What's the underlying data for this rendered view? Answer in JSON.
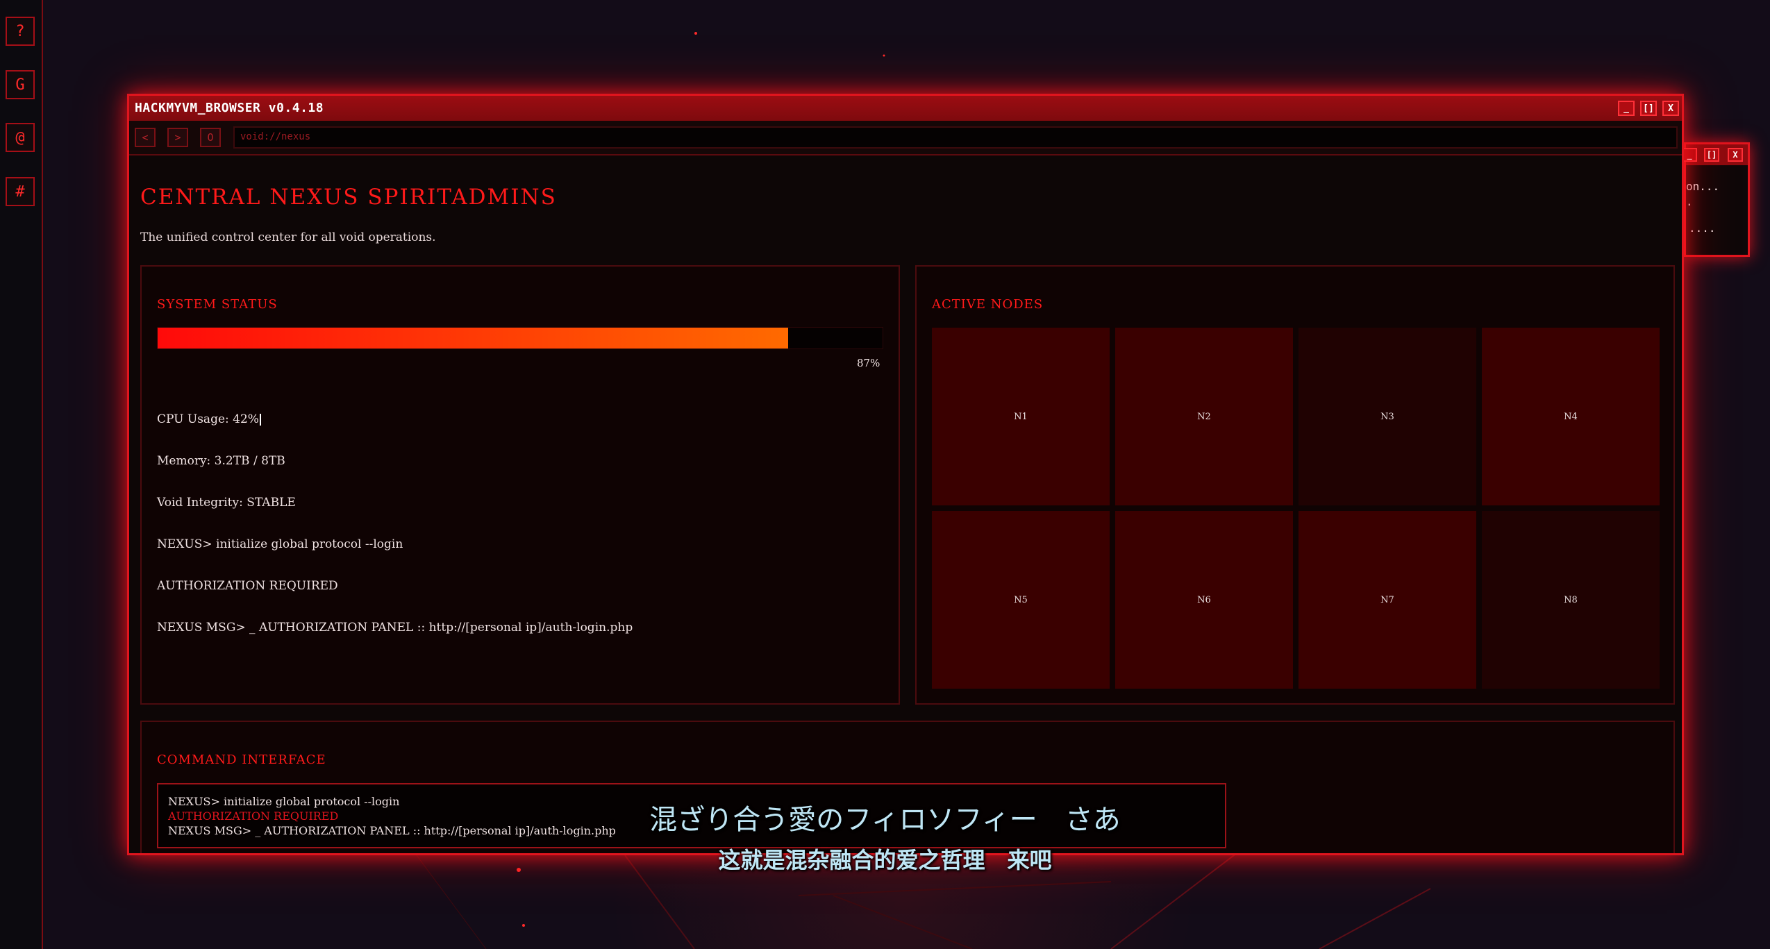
{
  "sidebar": {
    "items": [
      {
        "label": "?",
        "icon": "help-icon"
      },
      {
        "label": "G",
        "icon": "g-icon"
      },
      {
        "label": "@",
        "icon": "at-icon"
      },
      {
        "label": "#",
        "icon": "hash-icon"
      }
    ]
  },
  "back_window": {
    "lines": [
      "on...",
      ".",
      "...."
    ],
    "btn_min": "_",
    "btn_max": "[]",
    "btn_close": "X"
  },
  "window": {
    "title": "HACKMYVM_BROWSER v0.4.18",
    "btn_min": "_",
    "btn_max": "[]",
    "btn_close": "X"
  },
  "nav": {
    "back": "<",
    "forward": ">",
    "reload": "O",
    "url": "void://nexus"
  },
  "page": {
    "title": "CENTRAL NEXUS SPIRITADMINS",
    "subtitle": "The unified control center for all void operations."
  },
  "system_status": {
    "title": "SYSTEM STATUS",
    "progress": 0.87,
    "progress_label": "87%",
    "cpu": "CPU Usage: 42%",
    "memory": "Memory: 3.2TB / 8TB",
    "integrity": "Void Integrity: STABLE",
    "cmd": "NEXUS> initialize global protocol --login",
    "auth": "AUTHORIZATION REQUIRED",
    "msg": "NEXUS MSG> _ AUTHORIZATION PANEL :: http://[personal ip]/auth-login.php"
  },
  "active_nodes": {
    "title": "ACTIVE NODES",
    "nodes": [
      {
        "label": "N1",
        "color": "#3a0000"
      },
      {
        "label": "N2",
        "color": "#3a0000"
      },
      {
        "label": "N3",
        "color": "#200202"
      },
      {
        "label": "N4",
        "color": "#3a0000"
      },
      {
        "label": "N5",
        "color": "#3a0000"
      },
      {
        "label": "N6",
        "color": "#3a0000"
      },
      {
        "label": "N7",
        "color": "#3a0000"
      },
      {
        "label": "N8",
        "color": "#200202"
      }
    ]
  },
  "command_interface": {
    "title": "COMMAND INTERFACE",
    "lines": [
      {
        "text": "NEXUS> initialize global protocol --login",
        "color": "#efe2e2"
      },
      {
        "text": "AUTHORIZATION REQUIRED",
        "color": "#e0151e"
      },
      {
        "text": "NEXUS MSG> _ AUTHORIZATION PANEL :: http://[personal ip]/auth-login.php",
        "color": "#efe2e2"
      }
    ]
  },
  "subtitles": {
    "jp": "混ざり合う愛のフィロソフィー　さあ",
    "cn": "这就是混杂融合的爱之哲理　来吧"
  },
  "colors": {
    "accent": "#e0151e",
    "titlebar": "#8d0b0f",
    "progress_start": "#ff0a0a",
    "progress_end": "#ff6a00"
  }
}
